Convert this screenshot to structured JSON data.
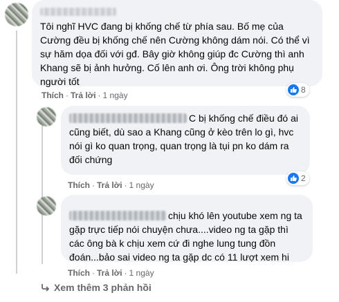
{
  "comments": [
    {
      "text": "Tôi nghĩ HVC đang bị khống chế từ phía sau. Bố mẹ của Cường đều bị khống chế nên Cường không dám nói. Có thể vì sự hăm dọa đối với gđ. Bây giờ không giúp đc Cường thì anh Khang sẽ bị ảnh hưởng. Cố lên anh ơi. Ông trời không phụ người tốt",
      "like_label": "Thích",
      "reply_label": "Trả lời",
      "time": "1 ngày",
      "reaction_count": "8"
    },
    {
      "text": "C bị khống chế điều đó ai cũng biết, dù sao a Khang cũng ở kèo trên lo gì, hvc nói gì ko quan trọng, quan trọng là tụi pn ko dám ra đối chứng",
      "like_label": "Thích",
      "reply_label": "Trả lời",
      "time": "1 ngày",
      "reaction_count": "2"
    },
    {
      "text": "chịu khó lên youtube xem ng ta gặp trực tiếp nói chuyện chưa....video ng ta gặp thì các ông bà k chịu xem cứ đi nghe lung tung đồn đoán...bảo sai video ng ta gặp dc có 11 lượt xem hi",
      "like_label": "Thích",
      "reply_label": "Trả lời",
      "time": "1 ngày"
    }
  ],
  "more_replies": "Xem thêm 3 phản hồi",
  "colors": {
    "bubble": "#f0f2f5",
    "like_blue": "#1877f2",
    "meta": "#65676b"
  },
  "icons": {
    "reaction": "like-thumb-icon",
    "more": "reply-arrow-icon"
  }
}
